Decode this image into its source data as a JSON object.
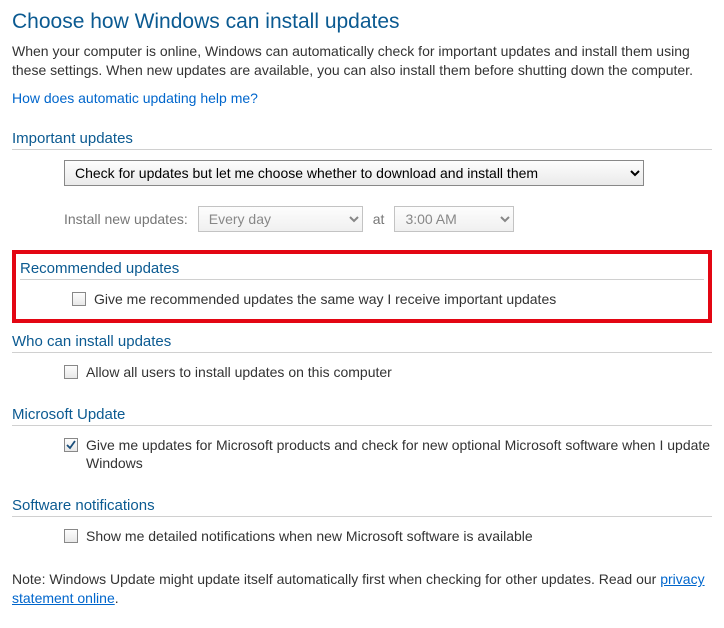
{
  "title": "Choose how Windows can install updates",
  "intro": "When your computer is online, Windows can automatically check for important updates and install them using these settings. When new updates are available, you can also install them before shutting down the computer.",
  "help_link": "How does automatic updating help me?",
  "sections": {
    "important": {
      "header": "Important updates",
      "selected": "Check for updates but let me choose whether to download and install them",
      "schedule_label": "Install new updates:",
      "day": "Every day",
      "at": "at",
      "time": "3:00 AM"
    },
    "recommended": {
      "header": "Recommended updates",
      "checkbox_label": "Give me recommended updates the same way I receive important updates"
    },
    "who": {
      "header": "Who can install updates",
      "checkbox_label": "Allow all users to install updates on this computer"
    },
    "msupdate": {
      "header": "Microsoft Update",
      "checkbox_label": "Give me updates for Microsoft products and check for new optional Microsoft software when I update Windows"
    },
    "notifications": {
      "header": "Software notifications",
      "checkbox_label": "Show me detailed notifications when new Microsoft software is available"
    }
  },
  "footnote_prefix": "Note: Windows Update might update itself automatically first when checking for other updates.  Read our ",
  "footnote_link": "privacy statement online",
  "footnote_suffix": "."
}
